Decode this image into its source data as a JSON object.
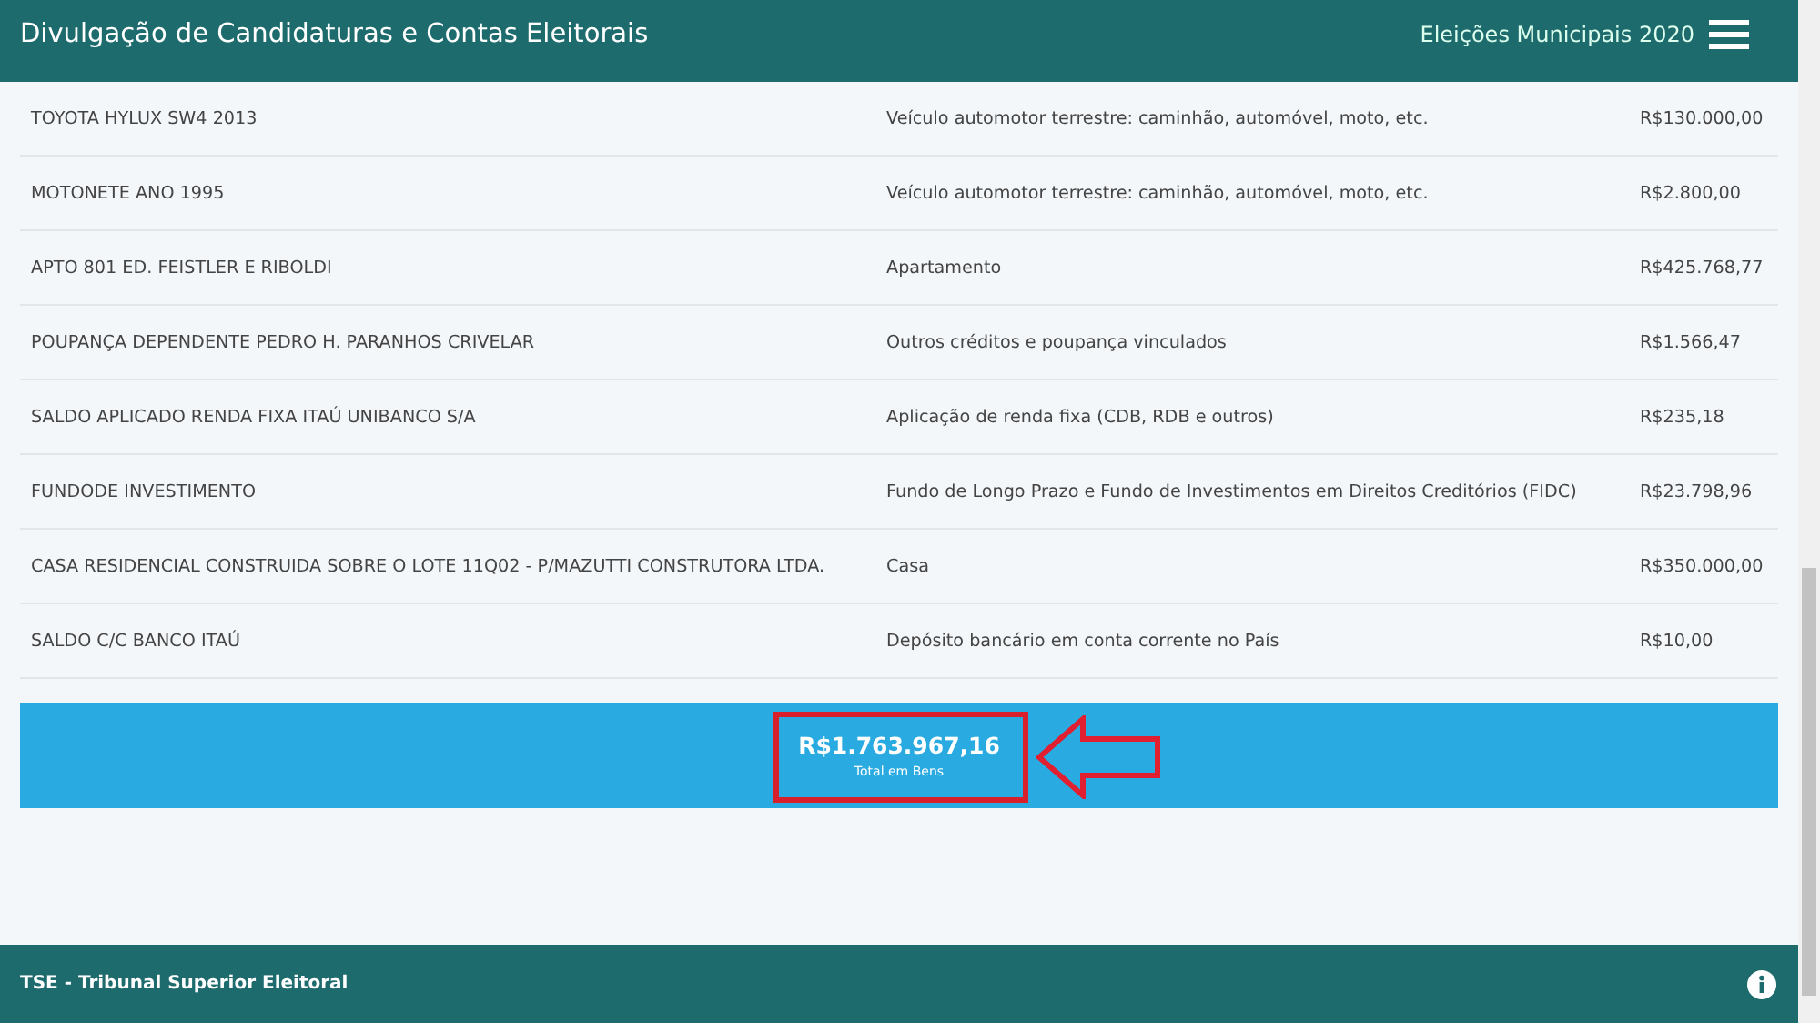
{
  "header": {
    "title": "Divulgação de Candidaturas e Contas Eleitorais",
    "election": "Eleições Municipais 2020"
  },
  "assets": [
    {
      "description": "TOYOTA HYLUX SW4 2013",
      "type": "Veículo automotor terrestre: caminhão, automóvel, moto, etc.",
      "value": "R$130.000,00"
    },
    {
      "description": "MOTONETE ANO 1995",
      "type": "Veículo automotor terrestre: caminhão, automóvel, moto, etc.",
      "value": "R$2.800,00"
    },
    {
      "description": "APTO 801 ED. FEISTLER E RIBOLDI",
      "type": "Apartamento",
      "value": "R$425.768,77"
    },
    {
      "description": "POUPANÇA DEPENDENTE PEDRO H. PARANHOS CRIVELAR",
      "type": "Outros créditos e poupança vinculados",
      "value": "R$1.566,47"
    },
    {
      "description": "SALDO APLICADO RENDA FIXA ITAÚ UNIBANCO S/A",
      "type": "Aplicação de renda fixa (CDB, RDB e outros)",
      "value": "R$235,18"
    },
    {
      "description": "FUNDODE INVESTIMENTO",
      "type": "Fundo de Longo Prazo e Fundo de Investimentos em Direitos Creditórios (FIDC)",
      "value": "R$23.798,96"
    },
    {
      "description": "CASA RESIDENCIAL CONSTRUIDA SOBRE O LOTE 11Q02 - P/MAZUTTI CONSTRUTORA LTDA.",
      "type": "Casa",
      "value": "R$350.000,00"
    },
    {
      "description": "SALDO C/C BANCO ITAÚ",
      "type": "Depósito bancário em conta corrente no País",
      "value": "R$10,00"
    }
  ],
  "total": {
    "value": "R$1.763.967,16",
    "label": "Total em Bens"
  },
  "footer": {
    "text": "TSE - Tribunal Superior Eleitoral"
  }
}
